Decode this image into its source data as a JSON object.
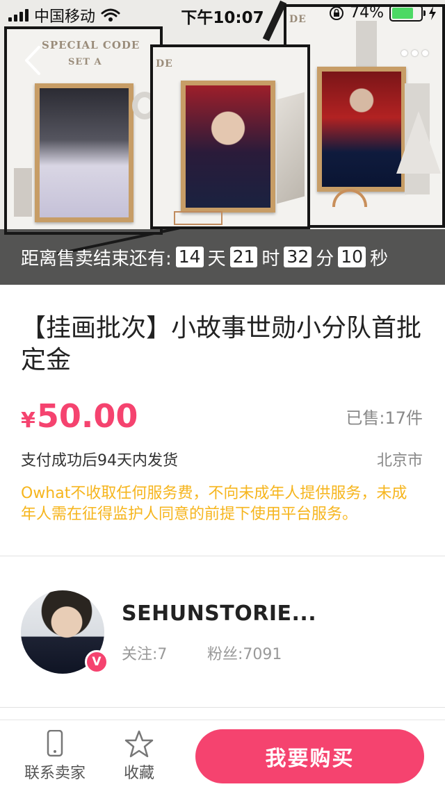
{
  "status_bar": {
    "carrier": "中国移动",
    "time": "下午10:07",
    "battery_percent": "74%",
    "battery_level": 0.74
  },
  "hero": {
    "card_headline": "SPECIAL CODE",
    "card_subline": "SET A",
    "card_code_short": "DE",
    "countdown": {
      "prefix": "距离售卖结束还有:",
      "days": "14",
      "days_unit": "天",
      "hours": "21",
      "hours_unit": "时",
      "minutes": "32",
      "minutes_unit": "分",
      "seconds": "10",
      "seconds_unit": "秒"
    }
  },
  "product": {
    "title": "【挂画批次】小故事世勋小分队首批定金",
    "currency": "¥",
    "price": "50.00",
    "sold": "已售:17件",
    "shipping": "支付成功后94天内发货",
    "location": "北京市",
    "notice": "Owhat不收取任何服务费，不向未成年人提供服务，未成年人需在征得监护人同意的前提下使用平台服务。"
  },
  "seller": {
    "name": "SEHUNSTORIE...",
    "following": "关注:7",
    "fans": "粉丝:7091",
    "badge": "V"
  },
  "bottom_bar": {
    "contact_label": "联系卖家",
    "favorite_label": "收藏",
    "buy_label": "我要购买"
  },
  "colors": {
    "accent": "#f5436f",
    "notice": "#f6b51d",
    "countdown_bg": "#191919"
  }
}
